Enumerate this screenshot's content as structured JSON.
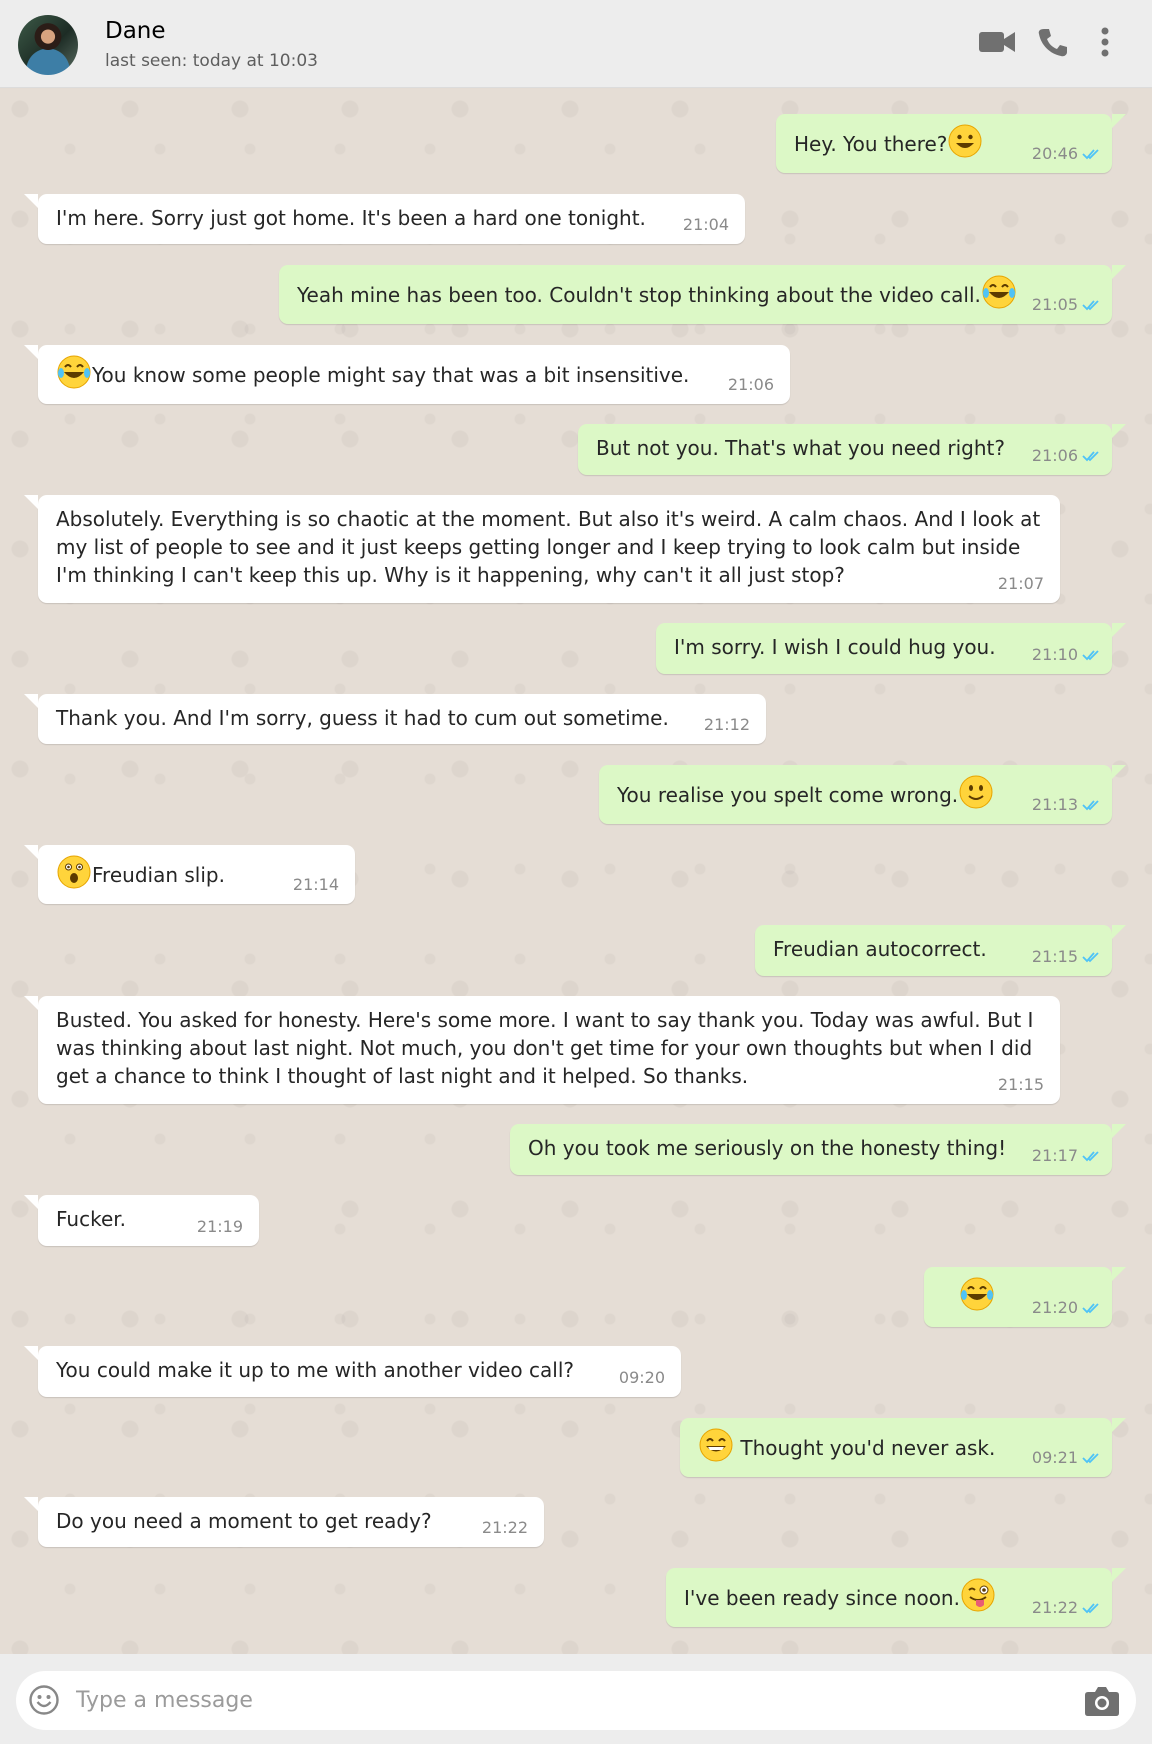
{
  "header": {
    "contact_name": "Dane",
    "last_seen": "last seen: today at 10:03",
    "avatar_icon": "profile-avatar",
    "icons": [
      "video-call-icon",
      "phone-icon",
      "more-options-icon"
    ]
  },
  "messages": [
    {
      "side": "out",
      "text": "Hey. You there?",
      "emoji_after": "grinning-face",
      "time": "20:46"
    },
    {
      "side": "in",
      "text": "I'm here. Sorry just got home. It's been a hard one tonight.",
      "time": "21:04"
    },
    {
      "side": "out",
      "text": "Yeah mine has been too. Couldn't stop thinking about the video call.",
      "emoji_after": "laughing-tears-face",
      "time": "21:05"
    },
    {
      "side": "in",
      "emoji_before": "laughing-tears-face",
      "text": "You know some people might say that was a bit insensitive.",
      "time": "21:06"
    },
    {
      "side": "out",
      "text": "But not you. That's what you need right?",
      "time": "21:06"
    },
    {
      "side": "in",
      "text": "Absolutely. Everything is so chaotic at the moment. But also it's weird. A calm chaos. And I look at my list of people to see and it just keeps getting longer and I keep trying to look calm but inside I'm thinking I can't keep this up. Why is it happening, why can't it all just stop?",
      "time": "21:07"
    },
    {
      "side": "out",
      "text": "I'm sorry. I wish I could hug you.",
      "time": "21:10"
    },
    {
      "side": "in",
      "text": "Thank you. And I'm sorry, guess it had to cum out sometime.",
      "time": "21:12"
    },
    {
      "side": "out",
      "text": "You realise you spelt come wrong.",
      "emoji_after": "slightly-smiling-face",
      "time": "21:13"
    },
    {
      "side": "in",
      "emoji_before": "astonished-face",
      "text": "Freudian slip.",
      "time": "21:14"
    },
    {
      "side": "out",
      "text": "Freudian autocorrect.",
      "time": "21:15"
    },
    {
      "side": "in",
      "text": "Busted. You asked for honesty. Here's some more. I want to say thank you. Today was awful. But I was thinking about last night. Not much, you don't get time for your own thoughts but when I did get a chance to think I thought of last night and it helped. So thanks.",
      "time": "21:15"
    },
    {
      "side": "out",
      "text": "Oh you took me seriously on the honesty thing!",
      "time": "21:17"
    },
    {
      "side": "in",
      "text": "Fucker.",
      "time": "21:19"
    },
    {
      "side": "out",
      "text": "",
      "emoji_only": "laughing-tears-face",
      "time": "21:20"
    },
    {
      "side": "in",
      "text": "You could make it up to me with another video call?",
      "time": "09:20"
    },
    {
      "side": "out",
      "emoji_before": "beaming-face",
      "text": "Thought you'd never ask.",
      "time": "09:21"
    },
    {
      "side": "in",
      "text": "Do you need a moment to get ready?",
      "time": "21:22"
    },
    {
      "side": "out",
      "text": "I've been ready since noon.",
      "emoji_after": "winking-tongue-face",
      "time": "21:22"
    }
  ],
  "composer": {
    "placeholder": "Type a message",
    "emoji_icon": "smiley-icon",
    "camera_icon": "camera-icon"
  },
  "colors": {
    "incoming_bubble": "#ffffff",
    "outgoing_bubble": "#dcf8c6",
    "read_ticks": "#4fc3f7",
    "chat_background": "#e5ddd5"
  }
}
